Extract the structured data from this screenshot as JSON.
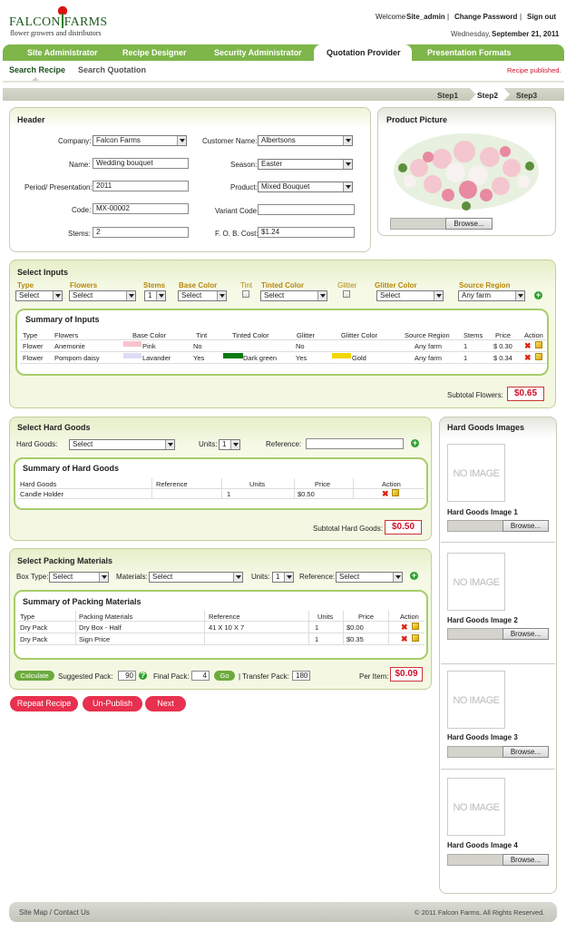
{
  "logo": {
    "name": "FALCON FARMS",
    "tagline": "flower growers and distributors"
  },
  "topnav": {
    "welcome": "Welcome",
    "user": "Site_admin",
    "sep": "|",
    "change_password": "Change Password",
    "sign_out": "Sign out"
  },
  "date": {
    "weekday": "Wednesday,",
    "date": "September 21, 2011"
  },
  "tabs": [
    "Site Administrator",
    "Recipe Designer",
    "Security Administrator",
    "Quotation Provider",
    "Presentation Formats"
  ],
  "subtabs": [
    "Search Recipe",
    "Search Quotation"
  ],
  "status": "Recipe published.",
  "steps": [
    "Step1",
    "Step2",
    "Step3"
  ],
  "header": {
    "title": "Header",
    "company_label": "Company:",
    "company": "Falcon Farms",
    "customer_label": "Customer Name:",
    "customer": "Albertsons",
    "name_label": "Name:",
    "name": "Wedding bouquet",
    "season_label": "Season:",
    "season": "Easter",
    "period_label": "Period/ Presentation:",
    "period": "2011",
    "product_label": "Product:",
    "product": "Mixed Bouquet",
    "code_label": "Code:",
    "code": "MX-00002",
    "variant_label": "Variant Code:",
    "variant": "",
    "stems_label": "Stems:",
    "stems": "2",
    "fob_label": "F. O. B. Cost:",
    "fob": "$1.24"
  },
  "product_picture": {
    "title": "Product Picture",
    "browse": "Browse..."
  },
  "inputs": {
    "title": "Select Inputs",
    "labels": {
      "type": "Type",
      "flowers": "Flowers",
      "stems": "Stems",
      "base_color": "Base Color",
      "tint": "Tint",
      "tinted_color": "Tinted Color",
      "glitter": "Glitter",
      "glitter_color": "Glitter Color",
      "source_region": "Source Region"
    },
    "values": {
      "type": "Select",
      "flowers": "Select",
      "stems": "1",
      "base_color": "Select",
      "tinted_color": "Select",
      "glitter_color": "Select",
      "source_region": "Any farm"
    },
    "summary_title": "Summary of Inputs",
    "columns": [
      "Type",
      "Flowers",
      "Base Color",
      "Tint",
      "Tinted Color",
      "Glitter",
      "Glitter Color",
      "Source Region",
      "Stems",
      "Price",
      "Action"
    ],
    "rows": [
      {
        "type": "Flower",
        "flower": "Anemonie",
        "base_color": "Pink",
        "base_swatch": "#f7c3cc",
        "tint": "No",
        "tinted_color": "",
        "tint_swatch": "",
        "glitter": "No",
        "glitter_color": "",
        "glitter_swatch": "",
        "source": "Any farm",
        "stems": "1",
        "price": "$ 0.30"
      },
      {
        "type": "Flower",
        "flower": "Pompom daisy",
        "base_color": "Lavander",
        "base_swatch": "#dcdcf4",
        "tint": "Yes",
        "tinted_color": "Dark green",
        "tint_swatch": "#0a7a12",
        "glitter": "Yes",
        "glitter_color": "Gold",
        "glitter_swatch": "#f2d800",
        "source": "Any farm",
        "stems": "1",
        "price": "$ 0.34"
      }
    ],
    "subtotal_label": "Subtotal Flowers:",
    "subtotal": "$0.65"
  },
  "hard_goods": {
    "title": "Select Hard Goods",
    "hg_label": "Hard Goods:",
    "hg_value": "Select",
    "units_label": "Units:",
    "units_value": "1",
    "ref_label": "Reference:",
    "ref_value": "",
    "summary_title": "Summary of Hard Goods",
    "columns": [
      "Hard Goods",
      "Reference",
      "Units",
      "Price",
      "Action"
    ],
    "rows": [
      {
        "name": "Candle Holder",
        "reference": "",
        "units": "1",
        "price": "$0.50"
      }
    ],
    "subtotal_label": "Subtotal Hard Goods:",
    "subtotal": "$0.50"
  },
  "hard_goods_images": {
    "title": "Hard Goods Images",
    "no_image": "NO IMAGE",
    "items": [
      "Hard Goods Image 1",
      "Hard Goods Image 2",
      "Hard Goods Image 3",
      "Hard Goods Image 4"
    ],
    "browse": "Browse..."
  },
  "packing": {
    "title": "Select Packing Materials",
    "box_label": "Box Type:",
    "box_value": "Select",
    "mat_label": "Materials:",
    "mat_value": "Select",
    "units_label": "Units:",
    "units_value": "1",
    "ref_label": "Reference:",
    "ref_value": "Select",
    "summary_title": "Summary of Packing Materials",
    "columns": [
      "Type",
      "Packing Materials",
      "Reference",
      "Units",
      "Price",
      "Action"
    ],
    "rows": [
      {
        "type": "Dry Pack",
        "material": "Dry Box - Half",
        "reference": "41 X 10 X 7",
        "units": "1",
        "price": "$0.00"
      },
      {
        "type": "Dry Pack",
        "material": "Sign Price",
        "reference": "",
        "units": "1",
        "price": "$0.35"
      }
    ],
    "calculate": "Calculate",
    "suggested_label": "Suggested Pack:",
    "suggested": "90",
    "final_label": "Final Pack:",
    "final": "4",
    "go": "Go",
    "transfer_label": "| Transfer Pack:",
    "transfer": "180",
    "per_item_label": "Per Item:",
    "per_item": "$0.09"
  },
  "actions": {
    "repeat": "Repeat Recipe",
    "unpublish": "Un-Publish",
    "next": "Next"
  },
  "footer": {
    "links": "Site Map / Contact Us",
    "copyright": "© 2011 Falcon Farms. All Rights Reserved."
  },
  "colors": {
    "nav_green": "#7eb64a",
    "accent_red": "#e8304f",
    "panel_green": "#e6efc9"
  }
}
